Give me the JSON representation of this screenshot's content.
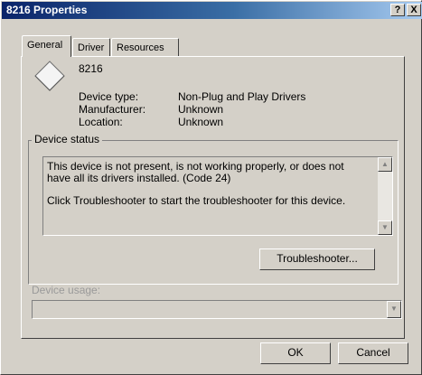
{
  "window": {
    "title": "8216 Properties",
    "help_button": "?",
    "close_button": "X"
  },
  "tabs": [
    {
      "label": "General",
      "active": true
    },
    {
      "label": "Driver",
      "active": false
    },
    {
      "label": "Resources",
      "active": false
    }
  ],
  "device": {
    "icon": "device-diamond-icon",
    "name": "8216",
    "info": [
      {
        "label": "Device type:",
        "value": "Non-Plug and Play Drivers"
      },
      {
        "label": "Manufacturer:",
        "value": "Unknown"
      },
      {
        "label": "Location:",
        "value": "Unknown"
      }
    ]
  },
  "status": {
    "group_label": "Device status",
    "lines": [
      "This device is not present, is not working properly, or does not",
      "have all its drivers installed. (Code 24)"
    ],
    "line_after_gap": "Click Troubleshooter to start the troubleshooter for this device.",
    "scroll_up_icon": "▲",
    "scroll_down_icon": "▼",
    "troubleshooter_label": "Troubleshooter..."
  },
  "usage": {
    "label": "Device usage:",
    "selected_value": "",
    "dropdown_icon": "▼",
    "disabled": true
  },
  "footer": {
    "ok_label": "OK",
    "cancel_label": "Cancel"
  },
  "colors": {
    "title_gradient_start": "#0a246a",
    "title_gradient_end": "#a6caf0",
    "face": "#d4d0c8"
  }
}
